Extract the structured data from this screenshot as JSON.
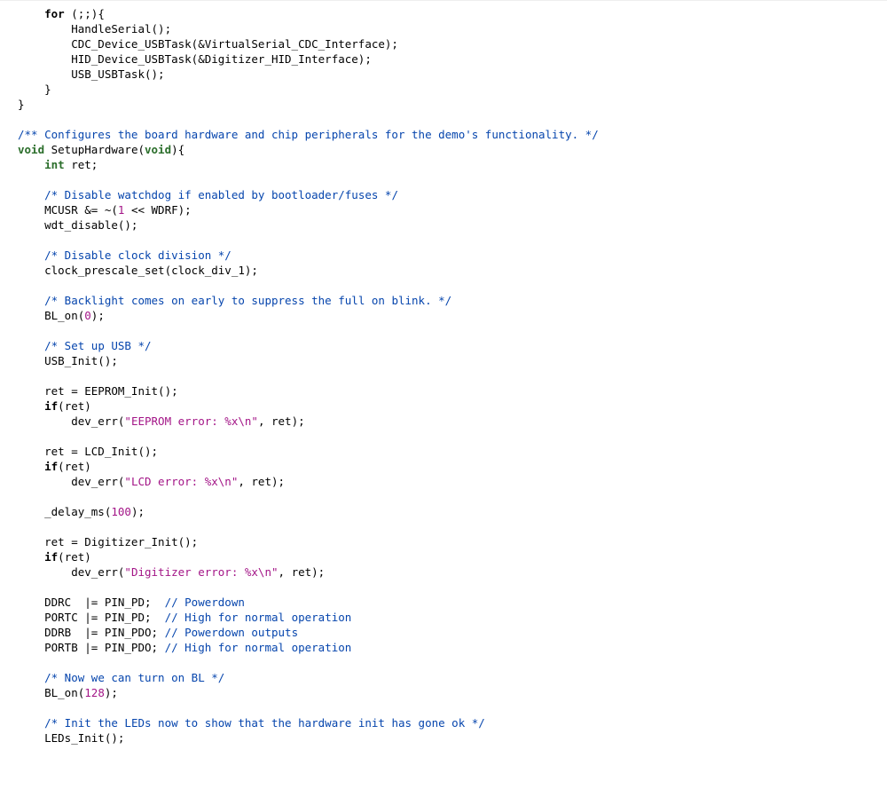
{
  "code": {
    "l01_for": "for",
    "l01_rest": " (;;){",
    "l02": "        HandleSerial();",
    "l03": "        CDC_Device_USBTask(&VirtualSerial_CDC_Interface);",
    "l04": "        HID_Device_USBTask(&Digitizer_HID_Interface);",
    "l05": "        USB_USBTask();",
    "l06": "    }",
    "l07": "}",
    "l09_comment": "/** Configures the board hardware and chip peripherals for the demo's functionality. */",
    "l10_void": "void",
    "l10_mid": " SetupHardware(",
    "l10_voidparam": "void",
    "l10_end": "){",
    "l11_int": "int",
    "l11_rest": " ret;",
    "l13_comment": "/* Disable watchdog if enabled by bootloader/fuses */",
    "l14_a": "    MCUSR &= ~(",
    "l14_num": "1",
    "l14_b": " << WDRF);",
    "l15": "    wdt_disable();",
    "l17_comment": "/* Disable clock division */",
    "l18": "    clock_prescale_set(clock_div_1);",
    "l20_comment": "/* Backlight comes on early to suppress the full on blink. */",
    "l21_a": "    BL_on(",
    "l21_num": "0",
    "l21_b": ");",
    "l23_comment": "/* Set up USB */",
    "l24": "    USB_Init();",
    "l26": "    ret = EEPROM_Init();",
    "l27_if": "if",
    "l27_rest": "(ret)",
    "l28_a": "        dev_err(",
    "l28_str": "\"EEPROM error: %x\\n\"",
    "l28_b": ", ret);",
    "l30": "    ret = LCD_Init();",
    "l31_if": "if",
    "l31_rest": "(ret)",
    "l32_a": "        dev_err(",
    "l32_str": "\"LCD error: %x\\n\"",
    "l32_b": ", ret);",
    "l34_a": "    _delay_ms(",
    "l34_num": "100",
    "l34_b": ");",
    "l36": "    ret = Digitizer_Init();",
    "l37_if": "if",
    "l37_rest": "(ret)",
    "l38_a": "        dev_err(",
    "l38_str": "\"Digitizer error: %x\\n\"",
    "l38_b": ", ret);",
    "l40_a": "    DDRC  |= PIN_PD;  ",
    "l40_c": "// Powerdown",
    "l41_a": "    PORTC |= PIN_PD;  ",
    "l41_c": "// High for normal operation",
    "l42_a": "    DDRB  |= PIN_PDO; ",
    "l42_c": "// Powerdown outputs",
    "l43_a": "    PORTB |= PIN_PDO; ",
    "l43_c": "// High for normal operation",
    "l45_comment": "/* Now we can turn on BL */",
    "l46_a": "    BL_on(",
    "l46_num": "128",
    "l46_b": ");",
    "l48_comment": "/* Init the LEDs now to show that the hardware init has gone ok */",
    "l49": "    LEDs_Init();"
  }
}
